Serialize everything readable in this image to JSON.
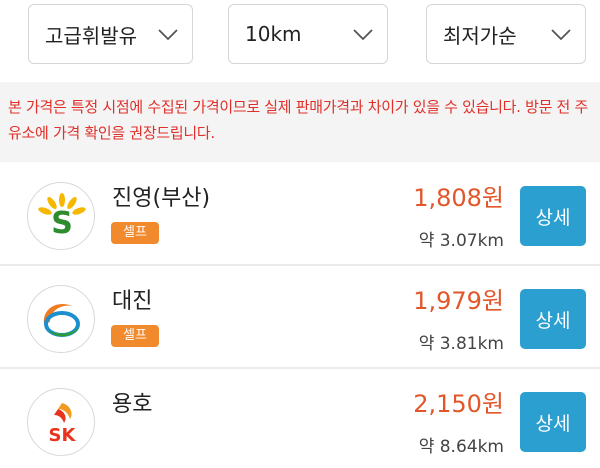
{
  "filters": {
    "fuel_type": "고급휘발유",
    "radius": "10km",
    "sort": "최저가순"
  },
  "notice": {
    "text": "본 가격은 특정 시점에 수집된 가격이므로 실제 판매가격과 차이가 있을 수 있습니다. 방문 전 주유소에 가격 확인을 권장드립니다."
  },
  "stations": [
    {
      "name": "진영(부산)",
      "badge": "셀프",
      "price": "1,808원",
      "distance": "약 3.07km",
      "detail_label": "상세",
      "brand_icon": "s-oil-logo-icon"
    },
    {
      "name": "대진",
      "badge": "셀프",
      "price": "1,979원",
      "distance": "약 3.81km",
      "detail_label": "상세",
      "brand_icon": "gs-caltex-logo-icon"
    },
    {
      "name": "용호",
      "price": "2,150원",
      "distance": "약 8.64km",
      "detail_label": "상세",
      "brand_icon": "sk-energy-logo-icon",
      "brand_text": "SK"
    }
  ],
  "colors": {
    "price": "#e2562a",
    "notice_text": "#e0302a",
    "badge": "#f08a2c",
    "detail_button": "#2a9fd0"
  }
}
